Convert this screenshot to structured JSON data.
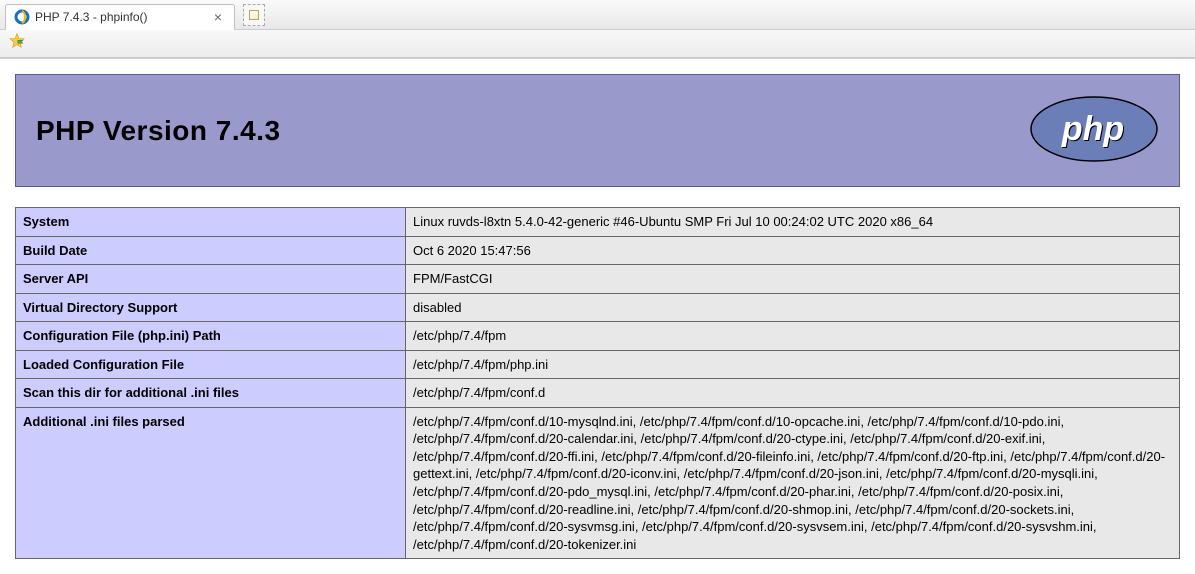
{
  "browser": {
    "tab_title": "PHP 7.4.3 - phpinfo()"
  },
  "header": {
    "title": "PHP Version 7.4.3"
  },
  "rows": [
    {
      "label": "System",
      "value": "Linux ruvds-l8xtn 5.4.0-42-generic #46-Ubuntu SMP Fri Jul 10 00:24:02 UTC 2020 x86_64"
    },
    {
      "label": "Build Date",
      "value": "Oct 6 2020 15:47:56"
    },
    {
      "label": "Server API",
      "value": "FPM/FastCGI"
    },
    {
      "label": "Virtual Directory Support",
      "value": "disabled"
    },
    {
      "label": "Configuration File (php.ini) Path",
      "value": "/etc/php/7.4/fpm"
    },
    {
      "label": "Loaded Configuration File",
      "value": "/etc/php/7.4/fpm/php.ini"
    },
    {
      "label": "Scan this dir for additional .ini files",
      "value": "/etc/php/7.4/fpm/conf.d"
    },
    {
      "label": "Additional .ini files parsed",
      "value": "/etc/php/7.4/fpm/conf.d/10-mysqlnd.ini, /etc/php/7.4/fpm/conf.d/10-opcache.ini, /etc/php/7.4/fpm/conf.d/10-pdo.ini, /etc/php/7.4/fpm/conf.d/20-calendar.ini, /etc/php/7.4/fpm/conf.d/20-ctype.ini, /etc/php/7.4/fpm/conf.d/20-exif.ini, /etc/php/7.4/fpm/conf.d/20-ffi.ini, /etc/php/7.4/fpm/conf.d/20-fileinfo.ini, /etc/php/7.4/fpm/conf.d/20-ftp.ini, /etc/php/7.4/fpm/conf.d/20-gettext.ini, /etc/php/7.4/fpm/conf.d/20-iconv.ini, /etc/php/7.4/fpm/conf.d/20-json.ini, /etc/php/7.4/fpm/conf.d/20-mysqli.ini, /etc/php/7.4/fpm/conf.d/20-pdo_mysql.ini, /etc/php/7.4/fpm/conf.d/20-phar.ini, /etc/php/7.4/fpm/conf.d/20-posix.ini, /etc/php/7.4/fpm/conf.d/20-readline.ini, /etc/php/7.4/fpm/conf.d/20-shmop.ini, /etc/php/7.4/fpm/conf.d/20-sockets.ini, /etc/php/7.4/fpm/conf.d/20-sysvmsg.ini, /etc/php/7.4/fpm/conf.d/20-sysvsem.ini, /etc/php/7.4/fpm/conf.d/20-sysvshm.ini, /etc/php/7.4/fpm/conf.d/20-tokenizer.ini"
    }
  ]
}
